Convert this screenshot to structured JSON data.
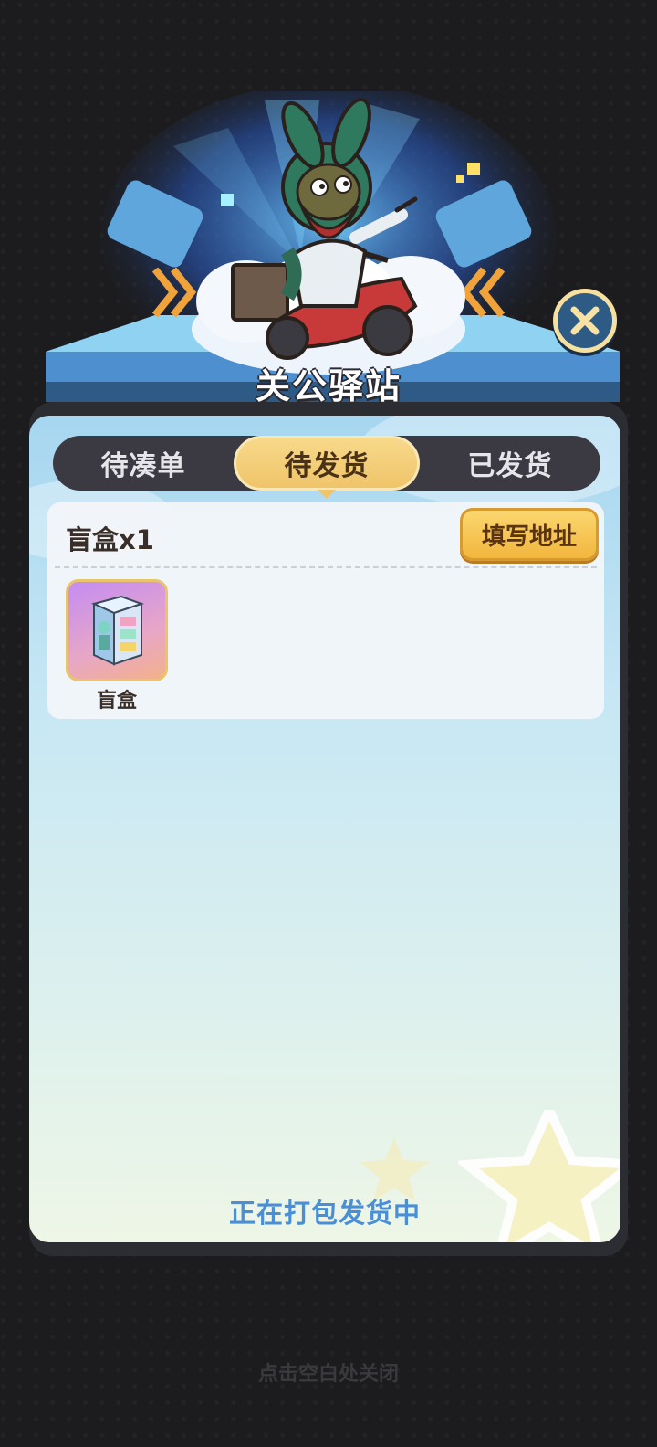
{
  "header": {
    "title": "关公驿站"
  },
  "tabs": [
    {
      "label": "待凑单"
    },
    {
      "label": "待发货"
    },
    {
      "label": "已发货"
    }
  ],
  "active_tab": "待发货",
  "order": {
    "title": "盲盒x1",
    "address_button": "填写地址",
    "items": [
      {
        "name": "盲盒",
        "icon": "blind-box-icon"
      }
    ]
  },
  "status": "正在打包发货中",
  "dismiss_hint": "点击空白处关闭",
  "colors": {
    "accent_gold": "#f0c46a",
    "status_blue": "#4a8fd6",
    "panel_dark": "#2c2c33"
  }
}
